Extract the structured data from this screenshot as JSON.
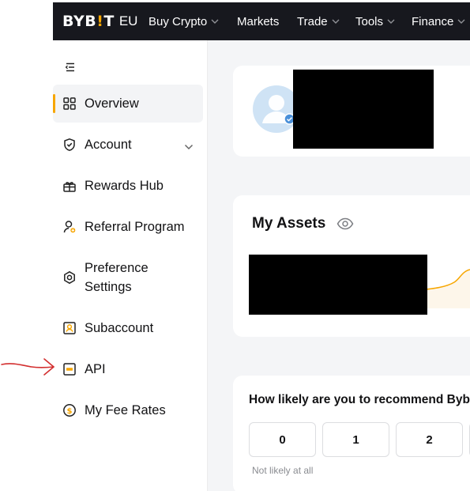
{
  "brand": {
    "logo_left": "BYB",
    "logo_accent": "!",
    "logo_right": "T",
    "region": "EU",
    "accent_color": "#f7a600"
  },
  "nav": {
    "items": [
      {
        "label": "Buy Crypto",
        "has_dropdown": true
      },
      {
        "label": "Markets",
        "has_dropdown": false
      },
      {
        "label": "Trade",
        "has_dropdown": true
      },
      {
        "label": "Tools",
        "has_dropdown": true
      },
      {
        "label": "Finance",
        "has_dropdown": true
      }
    ]
  },
  "sidebar": {
    "items": [
      {
        "label": "Overview",
        "icon": "grid-icon",
        "active": true
      },
      {
        "label": "Account",
        "icon": "shield-icon",
        "has_dropdown": true
      },
      {
        "label": "Rewards Hub",
        "icon": "gift-icon"
      },
      {
        "label": "Referral Program",
        "icon": "user-plus-icon"
      },
      {
        "label": "Preference Settings",
        "icon": "gear-icon"
      },
      {
        "label": "Subaccount",
        "icon": "subaccount-icon"
      },
      {
        "label": "API",
        "icon": "api-icon"
      },
      {
        "label": "My Fee Rates",
        "icon": "dollar-icon"
      }
    ]
  },
  "assets": {
    "title": "My Assets"
  },
  "nps": {
    "question": "How likely are you to recommend Byb",
    "scores": [
      "0",
      "1",
      "2"
    ],
    "low_label": "Not likely at all"
  },
  "annotation": {
    "arrow_color": "#d32f2f"
  }
}
